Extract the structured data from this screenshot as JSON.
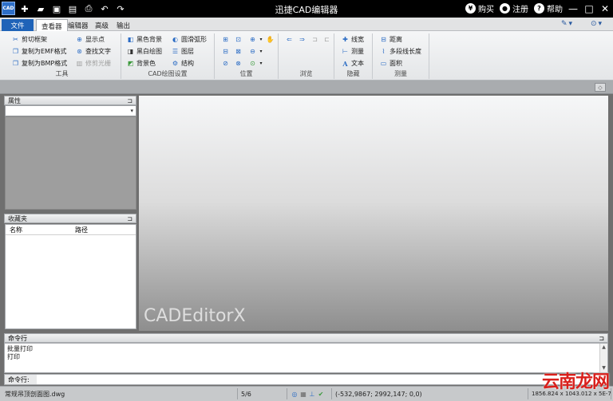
{
  "app": {
    "logo": "CAD",
    "title": "迅捷CAD编辑器"
  },
  "titlebar": {
    "quick_access": [
      {
        "name": "new-icon",
        "glyph": "✚"
      },
      {
        "name": "open-folder-icon",
        "glyph": "▰"
      },
      {
        "name": "save-icon",
        "glyph": "▣"
      },
      {
        "name": "save-as-icon",
        "glyph": "▤"
      },
      {
        "name": "print-icon",
        "glyph": "⎙"
      },
      {
        "name": "undo-icon",
        "glyph": "↶"
      },
      {
        "name": "redo-icon",
        "glyph": "↷"
      }
    ],
    "buy": "购买",
    "buy_icon": "¥",
    "register": "注册",
    "register_icon": "●",
    "help": "帮助",
    "help_icon": "?",
    "minimize": "—",
    "maximize": "□",
    "close": "✕"
  },
  "tabs": [
    "文件",
    "查看器",
    "编辑器",
    "高级",
    "输出"
  ],
  "tabbar_right": {
    "paint_icon": "✎",
    "chevron": "▾",
    "help_circle": "⊙"
  },
  "ribbon": {
    "tools": {
      "name": "工具",
      "items": [
        {
          "label": "剪切框架",
          "icon": "✂"
        },
        {
          "label": "复制为EMF格式",
          "icon": "❐"
        },
        {
          "label": "复制为BMP格式",
          "icon": "❐"
        },
        {
          "label": "显示点",
          "icon": "⊕"
        },
        {
          "label": "查找文字",
          "icon": "⊛"
        },
        {
          "label": "修剪光栅",
          "icon": "▥"
        }
      ]
    },
    "drawing": {
      "name": "CAD绘图设置",
      "items": [
        {
          "label": "黑色背景",
          "icon": "◧"
        },
        {
          "label": "黑白绘图",
          "icon": "◨"
        },
        {
          "label": "背景色",
          "icon": "◩"
        },
        {
          "label": "圆滑弧形",
          "icon": "◐"
        },
        {
          "label": "图层",
          "icon": "☰"
        },
        {
          "label": "结构",
          "icon": "⚙"
        }
      ]
    },
    "position": {
      "name": "位置",
      "items": [
        "⊞",
        "⊡",
        "⊕",
        "✋",
        "⊟",
        "⊠",
        "⊖",
        "⊘",
        "⊗",
        "⊙"
      ]
    },
    "browse": {
      "name": "浏览",
      "items": [
        "⇐",
        "⇒",
        "⊐",
        "⊏"
      ]
    },
    "hide": {
      "name": "隐藏",
      "items": [
        {
          "label": "线宽",
          "icon": "✚"
        },
        {
          "label": "测量",
          "icon": "⊢"
        },
        {
          "label": "文本",
          "icon": "A"
        }
      ]
    },
    "measure": {
      "name": "测量",
      "items": [
        {
          "label": "距离",
          "icon": "⊟"
        },
        {
          "label": "多段线长度",
          "icon": "⌇"
        },
        {
          "label": "面积",
          "icon": "▭"
        }
      ]
    }
  },
  "properties_panel": {
    "title": "属性",
    "pin": "⊐",
    "dropdown_arrow": "▾"
  },
  "favorites_panel": {
    "title": "收藏夹",
    "pin": "⊐",
    "columns": [
      "名称",
      "路径"
    ]
  },
  "canvas": {
    "watermark": "CADEditorX"
  },
  "command": {
    "title": "命令行",
    "pin": "⊐",
    "log": [
      "批量打印",
      "打印"
    ],
    "input_label": "命令行:",
    "input_value": ""
  },
  "statusbar": {
    "file": "常规吊顶剖面图.dwg",
    "page": "5/6",
    "coords": "(-532,9867; 2992,147; 0,0)",
    "size": "1856.824 x 1043.012 x 5E-7"
  },
  "site_watermark": "云南龙网"
}
